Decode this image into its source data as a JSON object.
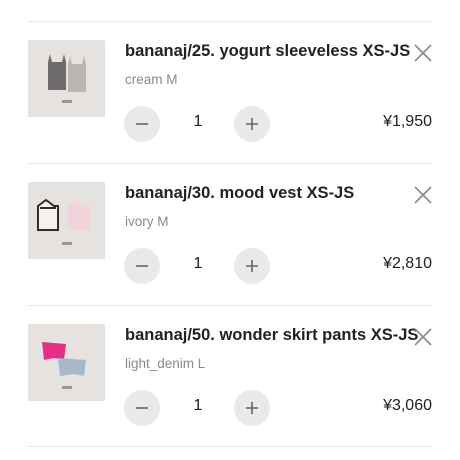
{
  "cart": {
    "items": [
      {
        "title": "bananaj/25. yogurt sleeveless XS-JS",
        "variant": "cream M",
        "quantity": "1",
        "price": "¥1,950",
        "thumb_icon": "sleeveless-top-product-image"
      },
      {
        "title": "bananaj/30. mood vest XS-JS",
        "variant": "ivory M",
        "quantity": "1",
        "price": "¥2,810",
        "thumb_icon": "knit-vest-product-image"
      },
      {
        "title": "bananaj/50. wonder skirt pants XS-JS",
        "variant": "light_denim L",
        "quantity": "1",
        "price": "¥3,060",
        "thumb_icon": "skirt-pants-product-image"
      }
    ]
  },
  "icons": {
    "remove": "close-icon",
    "decrease": "minus-icon",
    "increase": "plus-icon"
  },
  "colors": {
    "background": "#ffffff",
    "divider": "#e8e8e8",
    "stepper_bg": "#e9e9e9",
    "variant_text": "#8a8a8a"
  }
}
